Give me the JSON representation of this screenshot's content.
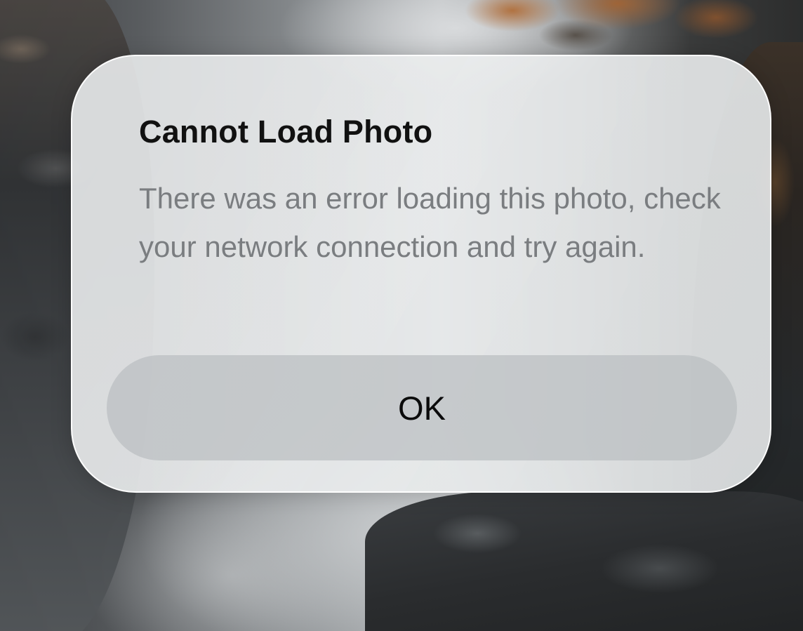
{
  "alert": {
    "title": "Cannot Load Photo",
    "message": "There was an error loading this photo, check your network connection and try again.",
    "ok_label": "OK"
  }
}
